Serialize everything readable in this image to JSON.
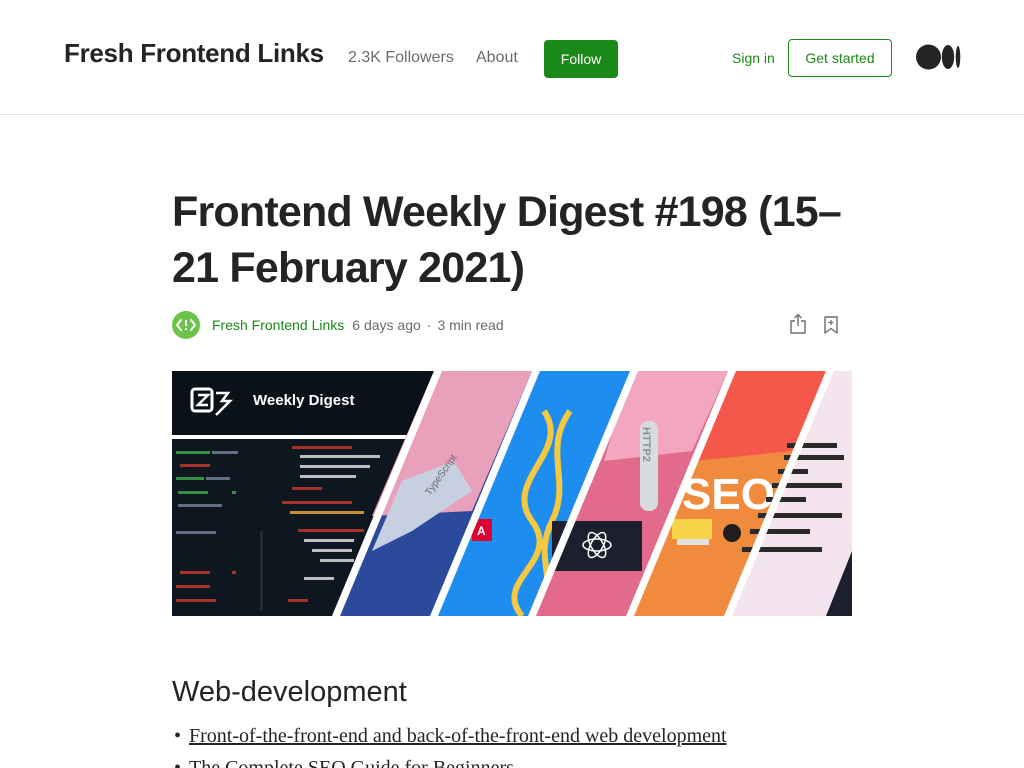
{
  "header": {
    "publication": "Fresh Frontend Links",
    "followers": "2.3K Followers",
    "about": "About",
    "follow": "Follow",
    "sign_in": "Sign in",
    "get_started": "Get started",
    "logo_icon": "medium-logo-icon"
  },
  "article": {
    "title": "Frontend Weekly Digest #198 (15–21 February 2021)",
    "author": "Fresh Frontend Links",
    "date": "6 days ago",
    "separator": "·",
    "read_time": "3 min read",
    "share_icon": "share-icon",
    "bookmark_icon": "bookmark-icon",
    "hero": {
      "banner_text": "Weekly Digest",
      "labels": [
        "TypeScript",
        "HTTP2",
        "SEO"
      ]
    },
    "section_title": "Web-development",
    "links": [
      "Front-of-the-front-end and back-of-the-front-end web development",
      "The Complete SEO Guide for Beginners"
    ]
  },
  "colors": {
    "accent": "#1a8917",
    "text": "#242424",
    "muted": "#6b6b6b",
    "avatar": "#6cc24a"
  }
}
